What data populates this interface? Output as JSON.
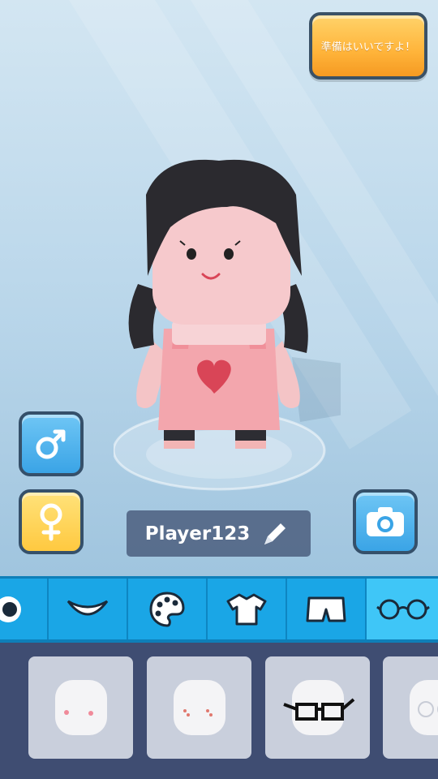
{
  "ready_button": {
    "label": "準備はいいですよ！"
  },
  "player": {
    "name": "Player123"
  },
  "gender_buttons": {
    "male_icon": "male-symbol-icon",
    "female_icon": "female-symbol-icon"
  },
  "camera_button": {
    "icon": "camera-icon"
  },
  "edit_button": {
    "icon": "pencil-icon"
  },
  "category_tabs": [
    {
      "icon": "eye-icon"
    },
    {
      "icon": "mouth-icon"
    },
    {
      "icon": "palette-icon"
    },
    {
      "icon": "tshirt-icon"
    },
    {
      "icon": "shorts-icon"
    },
    {
      "icon": "glasses-icon",
      "selected": true
    }
  ],
  "item_options": [
    {
      "icon": "blush-face-icon"
    },
    {
      "icon": "freckles-face-icon"
    },
    {
      "icon": "black-glasses-face-icon"
    },
    {
      "icon": "round-glasses-face-icon"
    }
  ],
  "colors": {
    "tab_bar": "#1aa6e6",
    "tab_selected": "#3fc6f7",
    "ready_button": "#ffb43a",
    "male_button": "#3aa4e6",
    "female_button": "#ffc940",
    "items_background": "#3f4d72"
  }
}
